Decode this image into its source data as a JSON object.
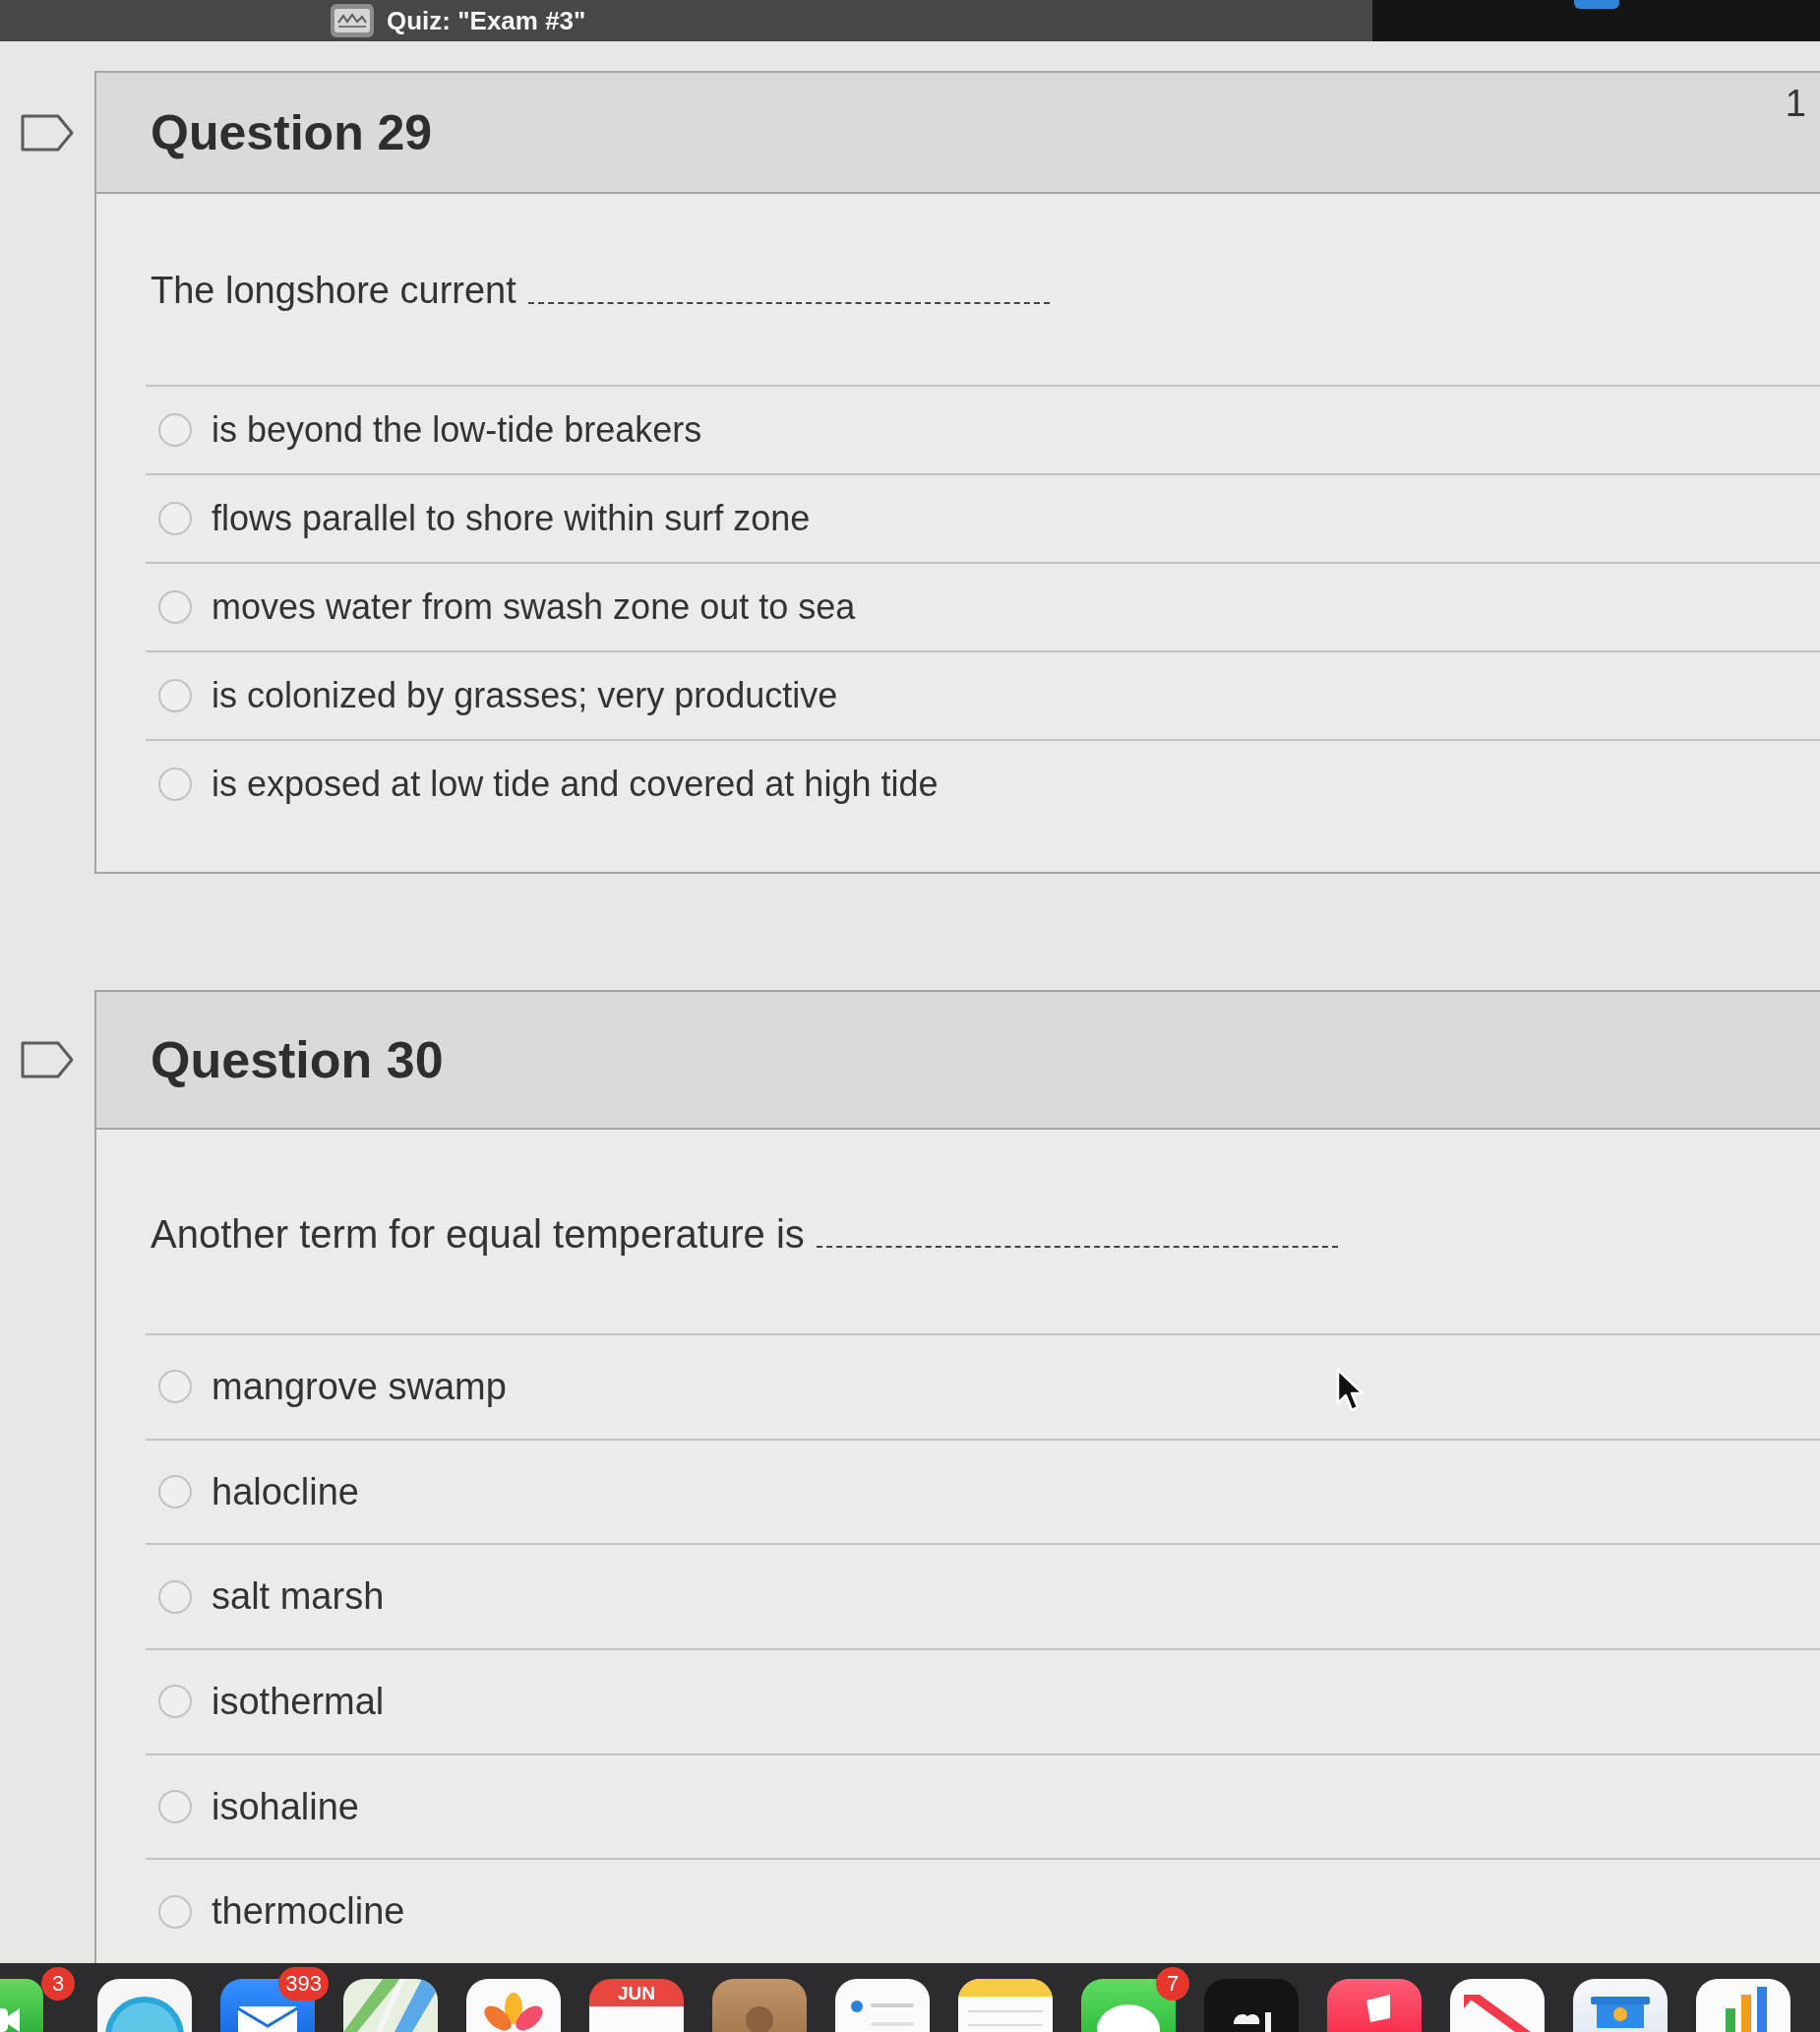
{
  "window": {
    "tab_title": "Quiz: \"Exam #3\""
  },
  "questions": [
    {
      "title": "Question 29",
      "points": "1",
      "flagged": false,
      "prompt": "The longshore current",
      "options": [
        {
          "label": "is beyond the low-tide breakers",
          "selected": false
        },
        {
          "label": "flows parallel to shore within surf zone",
          "selected": false
        },
        {
          "label": "moves water from swash zone out to sea",
          "selected": false
        },
        {
          "label": "is colonized by grasses; very productive",
          "selected": false
        },
        {
          "label": "is exposed at low tide and covered at high tide",
          "selected": false
        }
      ]
    },
    {
      "title": "Question 30",
      "flagged": false,
      "prompt": "Another term for equal temperature is",
      "options": [
        {
          "label": "mangrove swamp",
          "selected": false
        },
        {
          "label": "halocline",
          "selected": false
        },
        {
          "label": "salt marsh",
          "selected": false
        },
        {
          "label": "isothermal",
          "selected": false
        },
        {
          "label": "isohaline",
          "selected": false
        },
        {
          "label": "thermocline",
          "selected": false
        }
      ]
    }
  ],
  "dock": {
    "apps": [
      {
        "kind": "video",
        "badge": "3"
      },
      {
        "kind": "compass"
      },
      {
        "kind": "mail",
        "badge": "393"
      },
      {
        "kind": "map"
      },
      {
        "kind": "flower"
      },
      {
        "kind": "calendar",
        "month": "JUN"
      },
      {
        "kind": "contacts"
      },
      {
        "kind": "list"
      },
      {
        "kind": "notes"
      },
      {
        "kind": "chat",
        "badge": "7"
      },
      {
        "kind": "tv"
      },
      {
        "kind": "music"
      },
      {
        "kind": "news"
      },
      {
        "kind": "presentation"
      },
      {
        "kind": "chart"
      }
    ]
  }
}
